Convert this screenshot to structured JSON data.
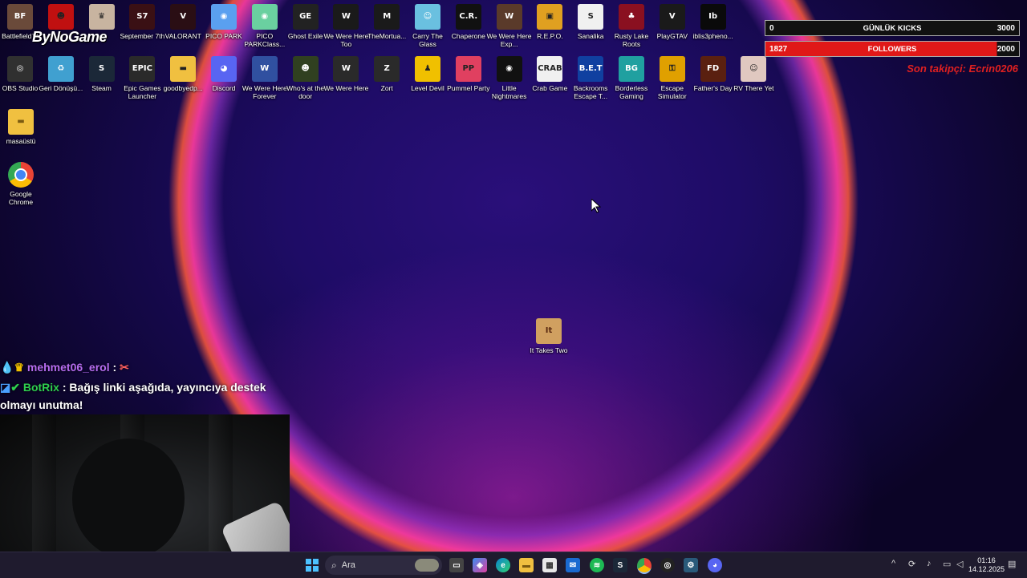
{
  "desktop": {
    "icons_row1": [
      {
        "label": "Battlefield™",
        "color": "#6a4a3a",
        "glyph": "BF"
      },
      {
        "label": "",
        "color": "#c01010",
        "glyph": "☻"
      },
      {
        "label": "",
        "color": "#c8b4a0",
        "glyph": "♛"
      },
      {
        "label": "September 7th",
        "color": "#3a1014",
        "glyph": "S7"
      },
      {
        "label": "VALORANT",
        "color": "#2a0e14",
        "glyph": "V"
      },
      {
        "label": "PICO PARK",
        "color": "#5aa0f0",
        "glyph": "◉"
      },
      {
        "label": "PICO PARKClass...",
        "color": "#6ad0a0",
        "glyph": "◉"
      },
      {
        "label": "Ghost Exile",
        "color": "#222",
        "glyph": "GE"
      },
      {
        "label": "We Were Here Too",
        "color": "#1a1a1a",
        "glyph": "W"
      },
      {
        "label": "TheMortua...",
        "color": "#1a1a1a",
        "glyph": "M"
      },
      {
        "label": "Carry The Glass",
        "color": "#6ac0e0",
        "glyph": "☺"
      },
      {
        "label": "Chaperone",
        "color": "#111",
        "glyph": "C.R."
      },
      {
        "label": "We Were Here Exp...",
        "color": "#5a3a2a",
        "glyph": "W"
      },
      {
        "label": "R.E.P.O.",
        "color": "#e0a020",
        "glyph": "▣"
      },
      {
        "label": "Sanalika",
        "color": "#f0f0f0",
        "glyph": "S"
      },
      {
        "label": "Rusty Lake Roots",
        "color": "#8a1020",
        "glyph": "♣"
      },
      {
        "label": "PlayGTAV",
        "color": "#1a1a1a",
        "glyph": "V"
      },
      {
        "label": "iblis3pheno...",
        "color": "#0a0a0a",
        "glyph": "Ib"
      }
    ],
    "icons_row2": [
      {
        "label": "OBS Studio",
        "color": "#303030",
        "glyph": "◎"
      },
      {
        "label": "Geri Dönüşü...",
        "color": "#40a0d0",
        "glyph": "♻"
      },
      {
        "label": "Steam",
        "color": "#1b2838",
        "glyph": "S"
      },
      {
        "label": "Epic Games Launcher",
        "color": "#2a2a2a",
        "glyph": "EPIC"
      },
      {
        "label": "goodbyedp...",
        "color": "#f0c040",
        "glyph": "▬"
      },
      {
        "label": "Discord",
        "color": "#5865f2",
        "glyph": "◕"
      },
      {
        "label": "We Were Here Forever",
        "color": "#3050a0",
        "glyph": "W"
      },
      {
        "label": "Who's at the door",
        "color": "#304020",
        "glyph": "☻"
      },
      {
        "label": "We Were Here",
        "color": "#2a2a2a",
        "glyph": "W"
      },
      {
        "label": "Zort",
        "color": "#2a2a2a",
        "glyph": "Z"
      },
      {
        "label": "Level Devil",
        "color": "#f0c000",
        "glyph": "♟"
      },
      {
        "label": "Pummel Party",
        "color": "#e04060",
        "glyph": "PP"
      },
      {
        "label": "Little Nightmares",
        "color": "#111",
        "glyph": "◉"
      },
      {
        "label": "Crab Game",
        "color": "#f0f0f0",
        "glyph": "CRAB"
      },
      {
        "label": "Backrooms Escape T...",
        "color": "#1040a0",
        "glyph": "B.E.T"
      },
      {
        "label": "Borderless Gaming",
        "color": "#20a0a0",
        "glyph": "BG"
      },
      {
        "label": "Escape Simulator",
        "color": "#e0a000",
        "glyph": "⚿"
      },
      {
        "label": "Father's Day",
        "color": "#5a2010",
        "glyph": "FD"
      },
      {
        "label": "RV There Yet",
        "color": "#e0c8c0",
        "glyph": "☺"
      }
    ],
    "col_icons": [
      {
        "label": "masaüstü",
        "color": "#f0c040",
        "glyph": "▬"
      },
      {
        "label": "Google Chrome",
        "color": "#ffffff",
        "glyph": "◉"
      }
    ],
    "center_icon": {
      "label": "It Takes Two",
      "color": "#d0a060",
      "glyph": "It"
    }
  },
  "overlay": {
    "logo": "ByNoGame",
    "kicks": {
      "left": "0",
      "title": "GÜNLÜK KICKS",
      "right": "3000"
    },
    "followers": {
      "left": "1827",
      "title": "FOLLOWERS",
      "right": "2000",
      "fill": 0.9135
    },
    "last_follower": "Son takipçi: Ecrin0206"
  },
  "chat": {
    "msg1_user": "mehmet06_erol",
    "msg1_sep": ":",
    "msg1_text": "✂",
    "msg2_user": "BotRix",
    "msg2_text": ": Bağış linki aşağıda, yayıncıya destek",
    "msg2_cont": "olmayı unutma!"
  },
  "taskbar": {
    "search_placeholder": "Ara",
    "time": "01:16",
    "date": "14.12.2025"
  }
}
